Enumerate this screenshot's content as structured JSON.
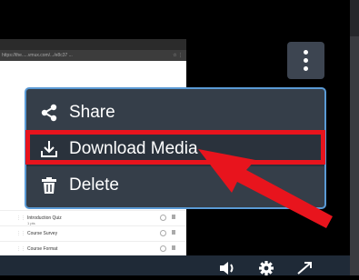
{
  "menu": {
    "items": [
      {
        "label": "Share",
        "icon": "share-icon"
      },
      {
        "label": "Download Media",
        "icon": "download-icon"
      },
      {
        "label": "Delete",
        "icon": "trash-icon"
      }
    ],
    "highlighted_index": 1
  },
  "thumbnail": {
    "url_text": "https://the.....vmux.com/.../e8c37 ...",
    "rows": [
      {
        "title": "Introduction Quiz",
        "sub": "1 pts"
      },
      {
        "title": "Course Survey",
        "sub": ""
      },
      {
        "title": "Course Format",
        "sub": ""
      }
    ]
  },
  "colors": {
    "menu_bg": "#353e49",
    "menu_border": "#5a9ad5",
    "annotation_red": "#e8141d",
    "button_bg": "#3d4551",
    "control_bar": "#1f2a37"
  },
  "controls": [
    "volume-icon",
    "settings-icon",
    "fullscreen-icon"
  ]
}
